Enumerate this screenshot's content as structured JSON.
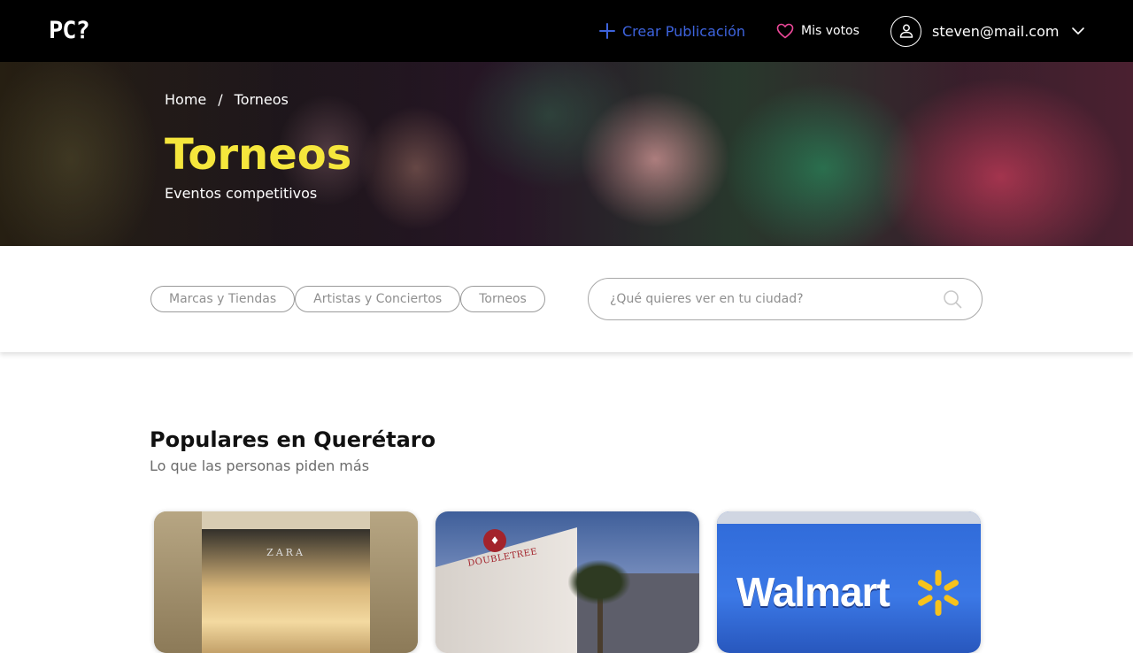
{
  "header": {
    "logo": "PC?",
    "create_label": "Crear Publicación",
    "votes_label": "Mis votos",
    "user_email": "steven@mail.com"
  },
  "hero": {
    "breadcrumb": [
      "Home",
      "Torneos"
    ],
    "breadcrumb_separator": "/",
    "title": "Torneos",
    "subtitle": "Eventos competitivos"
  },
  "filters": {
    "chips": [
      "Marcas y Tiendas",
      "Artistas y Conciertos",
      "Torneos"
    ],
    "search_placeholder": "¿Qué quieres ver en tu ciudad?"
  },
  "section": {
    "title": "Populares en Querétaro",
    "subtitle": "Lo que las personas piden más"
  },
  "cards": [
    {
      "image_text": "ZARA"
    },
    {
      "image_text": "DOUBLETREE"
    },
    {
      "image_text": "Walmart"
    }
  ],
  "icons": {
    "create": "plus-icon",
    "votes": "heart-icon",
    "user": "user-icon",
    "dropdown": "chevron-down-icon",
    "search": "search-icon"
  },
  "colors": {
    "topbar": "#000000",
    "link_blue": "#3d63dd",
    "heart_pink": "#ec4899",
    "hero_title_yellow": "#f5e63c",
    "chip_border": "#9a9a9a",
    "walmart_blue": "#2f6ad8",
    "walmart_yellow": "#f7c21c"
  }
}
